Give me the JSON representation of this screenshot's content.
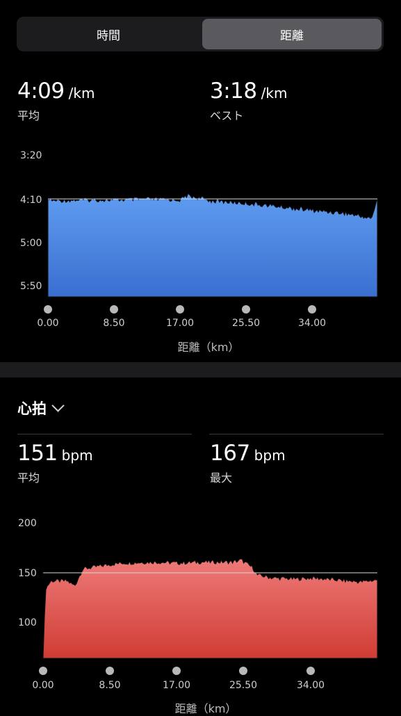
{
  "segment": {
    "time_label": "時間",
    "distance_label": "距離",
    "selected": "distance"
  },
  "pace": {
    "avg_value": "4:09",
    "avg_unit": "/km",
    "avg_label": "平均",
    "best_value": "3:18",
    "best_unit": "/km",
    "best_label": "ベスト",
    "y_ticks": [
      "3:20",
      "4:10",
      "5:00",
      "5:50"
    ],
    "x_ticks": [
      "0.00",
      "8.50",
      "17.00",
      "25.50",
      "34.00"
    ],
    "x_axis_title": "距離（km）",
    "color_top": "#5f9cf0",
    "color_bottom": "#3a6fd0"
  },
  "heart": {
    "section_title": "心拍",
    "avg_value": "151",
    "avg_unit": "bpm",
    "avg_label": "平均",
    "max_value": "167",
    "max_unit": "bpm",
    "max_label": "最大",
    "y_ticks": [
      "200",
      "150",
      "100"
    ],
    "x_ticks": [
      "0.00",
      "8.50",
      "17.00",
      "25.50",
      "34.00"
    ],
    "x_axis_title": "距離（km）",
    "color_top": "#ee7a78",
    "color_bottom": "#d03c34"
  },
  "chart_data": [
    {
      "type": "area",
      "x": [
        0,
        0.5,
        4,
        8.5,
        12.75,
        17,
        17.8,
        21,
        25.5,
        28,
        34,
        38,
        41.5,
        42.2
      ],
      "y": [
        249,
        251,
        250,
        250,
        249,
        250,
        245,
        251,
        254,
        256,
        262,
        265,
        271,
        248
      ],
      "xlim": [
        0,
        42.2
      ],
      "ylim": [
        200,
        360
      ],
      "xlabel": "距離（km）",
      "y_tick_labels": [
        "3:20",
        "4:10",
        "5:00",
        "5:50"
      ],
      "x_tick_labels": [
        "0.00",
        "8.50",
        "17.00",
        "25.50",
        "34.00"
      ],
      "reference_line": 249,
      "y_axis_inverted": true
    },
    {
      "type": "area",
      "x": [
        0,
        0.3,
        1,
        3,
        4,
        5,
        8,
        10,
        14,
        17,
        20,
        24,
        25,
        26.5,
        27,
        29,
        32,
        34,
        37,
        40,
        42.2
      ],
      "y": [
        65,
        135,
        143,
        143,
        138,
        155,
        159,
        161,
        162,
        161,
        162,
        162,
        164,
        156,
        149,
        146,
        145,
        146,
        144,
        142,
        144
      ],
      "xlim": [
        0,
        42.2
      ],
      "ylim": [
        65,
        200
      ],
      "xlabel": "距離（km）",
      "y_tick_labels": [
        "200",
        "150",
        "100"
      ],
      "x_tick_labels": [
        "0.00",
        "8.50",
        "17.00",
        "25.50",
        "34.00"
      ],
      "reference_line": 151
    }
  ]
}
